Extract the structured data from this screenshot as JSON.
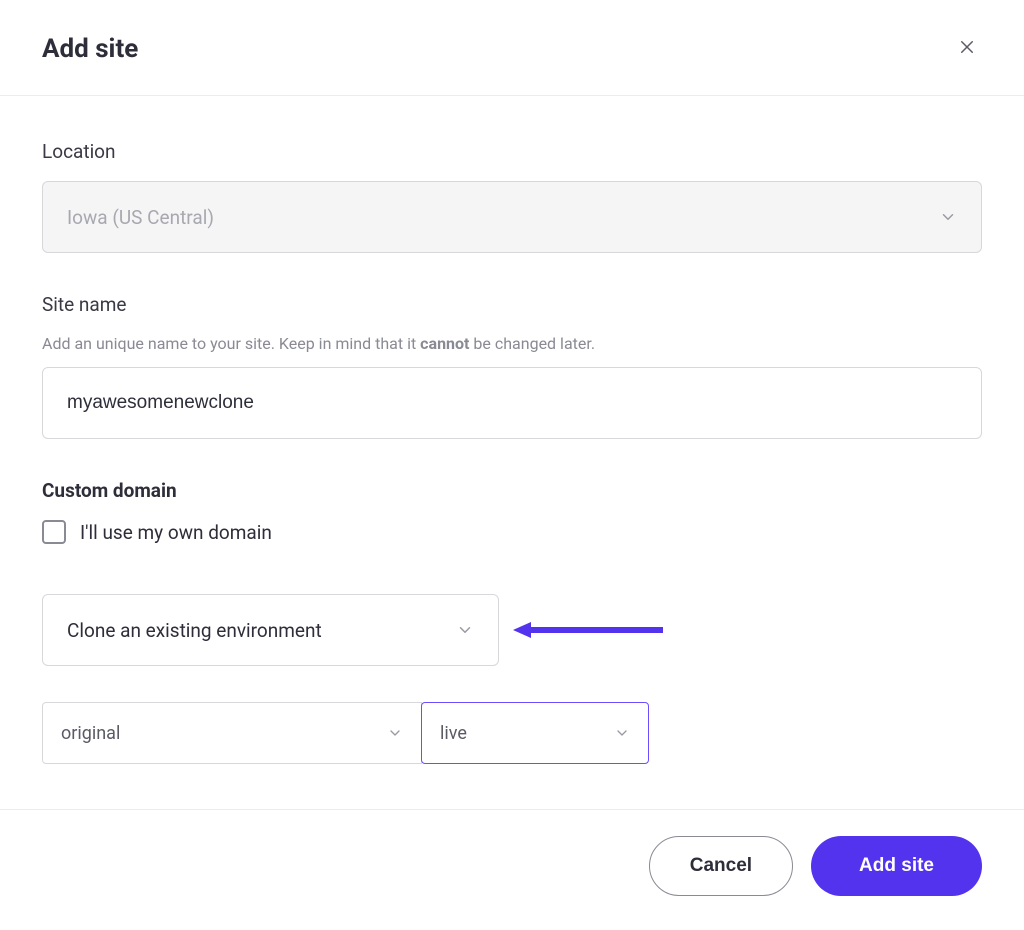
{
  "header": {
    "title": "Add site"
  },
  "location": {
    "label": "Location",
    "value": "Iowa (US Central)"
  },
  "sitename": {
    "label": "Site name",
    "helper_pre": "Add an unique name to your site. Keep in mind that it ",
    "helper_bold": "cannot",
    "helper_post": " be changed later.",
    "value": "myawesomenewclone"
  },
  "customdomain": {
    "label": "Custom domain",
    "checkbox_label": "I'll use my own domain"
  },
  "clone": {
    "select_value": "Clone an existing environment"
  },
  "envs": {
    "source": "original",
    "target": "live"
  },
  "footer": {
    "cancel": "Cancel",
    "submit": "Add site"
  }
}
